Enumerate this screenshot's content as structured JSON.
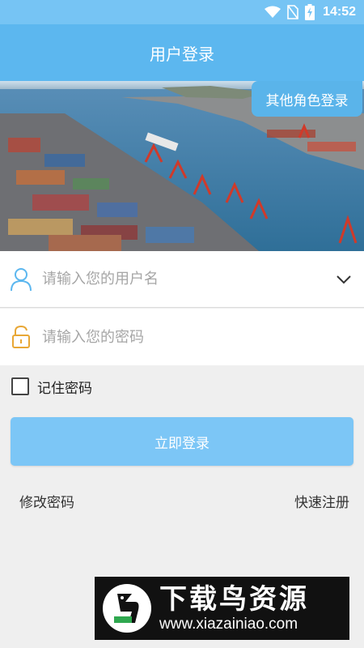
{
  "status_bar": {
    "time": "14:52",
    "icons": [
      "wifi-icon",
      "no-sim-icon",
      "battery-charging-icon"
    ]
  },
  "header": {
    "title": "用户登录"
  },
  "banner": {
    "image": "port container terminal aerial photo",
    "role_button_label": "其他角色登录"
  },
  "form": {
    "username_placeholder": "请输入您的用户名",
    "username_value": "",
    "password_placeholder": "请输入您的密码",
    "password_value": "",
    "remember_label": "记住密码",
    "remember_checked": false,
    "login_label": "立即登录"
  },
  "links": {
    "change_password": "修改密码",
    "quick_register": "快速注册"
  },
  "watermark": {
    "title": "下载鸟资源",
    "url": "www.xiazainiao.com"
  },
  "colors": {
    "primary": "#5cb7ef",
    "status_bar": "#76c4f4",
    "button": "#7cc6f6",
    "page_bg": "#efefef",
    "icon_user": "#5cb7ef",
    "icon_lock": "#e8a735"
  }
}
